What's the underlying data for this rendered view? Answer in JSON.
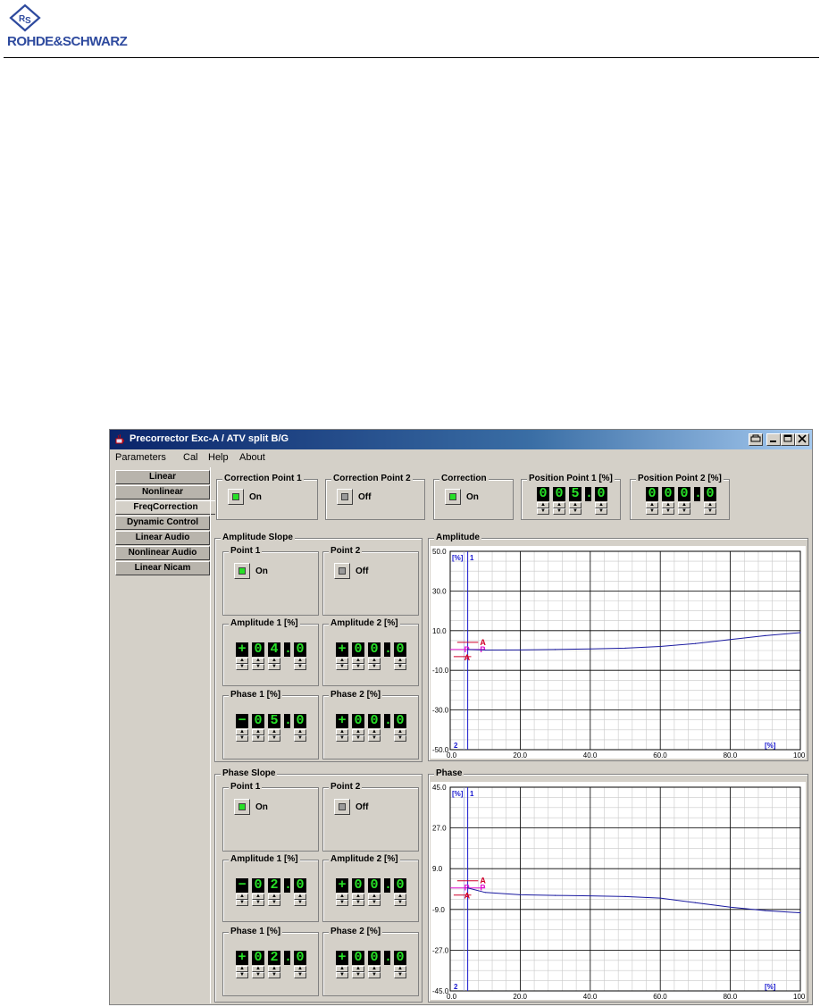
{
  "brand": {
    "name": "ROHDE&SCHWARZ"
  },
  "window": {
    "title": "Precorrector Exc-A /  ATV split B/G",
    "icons": {
      "app": "cup-icon",
      "print": "printer-icon",
      "minimize": "minimize-icon",
      "maximize": "maximize-icon",
      "close": "close-icon"
    }
  },
  "menu": [
    "Parameters",
    "Cal",
    "Help",
    "About"
  ],
  "tabs": [
    "Linear",
    "Nonlinear",
    "FreqCorrection",
    "Dynamic Control",
    "Linear Audio",
    "Nonlinear Audio",
    "Linear Nicam"
  ],
  "selected_tab": "FreqCorrection",
  "top": {
    "cp1": {
      "title": "Correction Point 1",
      "state": "On",
      "on": true
    },
    "cp2": {
      "title": "Correction Point 2",
      "state": "Off",
      "on": false
    },
    "corr": {
      "title": "Correction",
      "state": "On",
      "on": true
    },
    "pos1": {
      "title": "Position Point 1 [%]",
      "digits": [
        "0",
        "0",
        "5",
        ".",
        "0"
      ]
    },
    "pos2": {
      "title": "Position Point 2 [%]",
      "digits": [
        "0",
        "0",
        "0",
        ".",
        "0"
      ]
    }
  },
  "amp_slope": {
    "title": "Amplitude Slope",
    "p1": {
      "title": "Point 1",
      "state": "On",
      "on": true
    },
    "p2": {
      "title": "Point 2",
      "state": "Off",
      "on": false
    },
    "a1": {
      "title": "Amplitude 1 [%]",
      "digits": [
        "+",
        "0",
        "4",
        ".",
        "0"
      ]
    },
    "a2": {
      "title": "Amplitude 2 [%]",
      "digits": [
        "+",
        "0",
        "0",
        ".",
        "0"
      ]
    },
    "ph1": {
      "title": "Phase 1 [%]",
      "digits": [
        "−",
        "0",
        "5",
        ".",
        "0"
      ]
    },
    "ph2": {
      "title": "Phase 2 [%]",
      "digits": [
        "+",
        "0",
        "0",
        ".",
        "0"
      ]
    }
  },
  "phase_slope": {
    "title": "Phase Slope",
    "p1": {
      "title": "Point 1",
      "state": "On",
      "on": true
    },
    "p2": {
      "title": "Point 2",
      "state": "Off",
      "on": false
    },
    "a1": {
      "title": "Amplitude 1 [%]",
      "digits": [
        "−",
        "0",
        "2",
        ".",
        "0"
      ]
    },
    "a2": {
      "title": "Amplitude 2 [%]",
      "digits": [
        "+",
        "0",
        "0",
        ".",
        "0"
      ]
    },
    "ph1": {
      "title": "Phase 1 [%]",
      "digits": [
        "+",
        "0",
        "2",
        ".",
        "0"
      ]
    },
    "ph2": {
      "title": "Phase 2 [%]",
      "digits": [
        "+",
        "0",
        "0",
        ".",
        "0"
      ]
    }
  },
  "chart_data": [
    {
      "type": "line",
      "title": "Amplitude",
      "xlim": [
        0,
        100
      ],
      "ylim": [
        -50,
        50
      ],
      "xticks": [
        "0.0",
        "20.0",
        "40.0",
        "60.0",
        "80.0",
        "100."
      ],
      "yticks": [
        "50.0",
        "30.0",
        "10.0",
        "-10.0",
        "-30.0",
        "-50.0"
      ],
      "xunit": "[%]",
      "yunit": "[%]",
      "marker1": "1",
      "marker2": "2",
      "point_labels": [
        "A",
        "P",
        "A",
        "P"
      ],
      "grid": true,
      "x": [
        5,
        10,
        20,
        30,
        40,
        50,
        60,
        70,
        80,
        90,
        100
      ],
      "y": [
        0.5,
        0.2,
        0.3,
        0.5,
        0.8,
        1.2,
        2.0,
        3.5,
        5.5,
        7.5,
        9.0
      ],
      "line_color": "#1a1aa0"
    },
    {
      "type": "line",
      "title": "Phase",
      "xlim": [
        0,
        100
      ],
      "ylim": [
        -45,
        45
      ],
      "xticks": [
        "0.0",
        "20.0",
        "40.0",
        "60.0",
        "80.0",
        "100."
      ],
      "yticks": [
        "45.0",
        "27.0",
        "9.0",
        "-9.0",
        "-27.0",
        "-45.0"
      ],
      "xunit": "[%]",
      "yunit": "[%]",
      "marker1": "1",
      "marker2": "2",
      "point_labels": [
        "A",
        "P",
        "A",
        "P"
      ],
      "grid": true,
      "x": [
        5,
        10,
        20,
        30,
        40,
        50,
        60,
        70,
        80,
        90,
        100
      ],
      "y": [
        0.5,
        -1.5,
        -2.5,
        -2.8,
        -3.0,
        -3.3,
        -4.0,
        -6.0,
        -8.0,
        -9.5,
        -10.5
      ],
      "line_color": "#1a1aa0"
    }
  ],
  "colors": {
    "led_on": "#27e027",
    "led_off": "#9a9a9a",
    "marker": "#d0002a",
    "marker_alt": "#e010d0",
    "axis_blue": "#1a1ad0"
  }
}
